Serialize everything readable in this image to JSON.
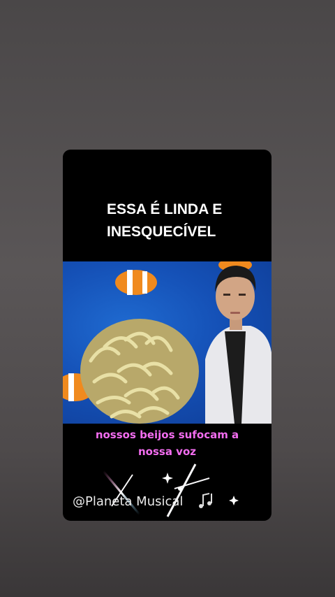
{
  "story": {
    "headline_line1": "ESSA É LINDA E",
    "headline_line2": "INESQUECÍVEL",
    "caption_line1": "nossos beijos sufocam a",
    "caption_line2": "nossa voz",
    "watermark": "@Planeta Musical"
  },
  "colors": {
    "background": "#4e4a4b",
    "card": "#000000",
    "caption": "#f36df0",
    "video_sea": "#1551b7"
  },
  "icons": [
    "sparkle-icon",
    "music-notes-icon"
  ]
}
